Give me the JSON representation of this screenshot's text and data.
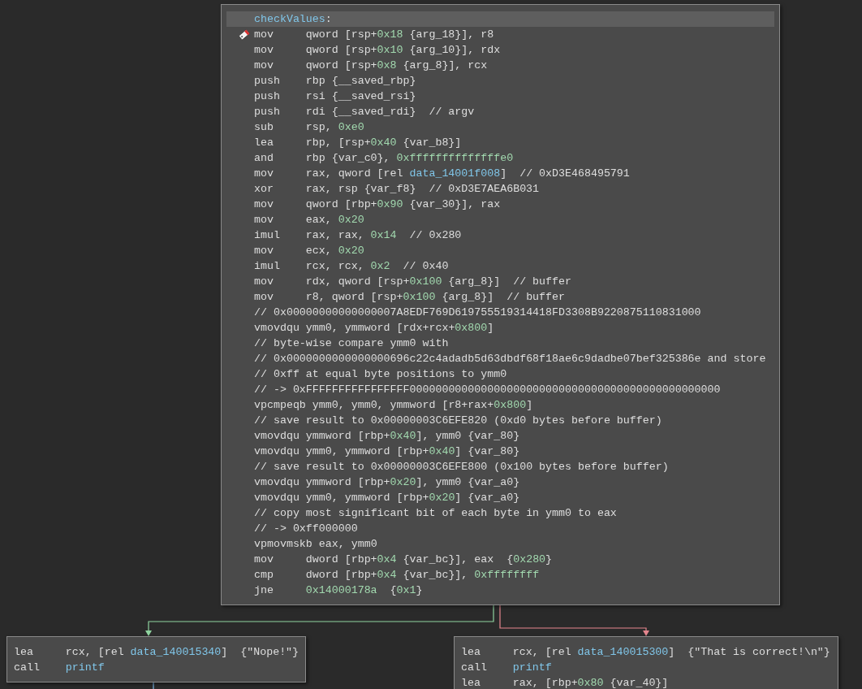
{
  "graph": {
    "blocks": [
      {
        "label": "checkValues:",
        "lines": [
          {
            "kind": "instr",
            "mnemonic": "mov",
            "operands": "qword [rsp+0x18 {arg_18}], r8",
            "tagged": true
          },
          {
            "kind": "instr",
            "mnemonic": "mov",
            "operands": "qword [rsp+0x10 {arg_10}], rdx"
          },
          {
            "kind": "instr",
            "mnemonic": "mov",
            "operands": "qword [rsp+0x8 {arg_8}], rcx"
          },
          {
            "kind": "instr",
            "mnemonic": "push",
            "operands": "rbp {__saved_rbp}"
          },
          {
            "kind": "instr",
            "mnemonic": "push",
            "operands": "rsi {__saved_rsi}"
          },
          {
            "kind": "instr",
            "mnemonic": "push",
            "operands": "rdi {__saved_rdi}  // argv"
          },
          {
            "kind": "instr",
            "mnemonic": "sub",
            "operands": "rsp, 0xe0"
          },
          {
            "kind": "instr",
            "mnemonic": "lea",
            "operands": "rbp, [rsp+0x40 {var_b8}]"
          },
          {
            "kind": "instr",
            "mnemonic": "and",
            "operands": "rbp {var_c0}, 0xffffffffffffffe0"
          },
          {
            "kind": "instr",
            "mnemonic": "mov",
            "operands": "rax, qword [rel data_14001f008]  // 0xD3E468495791"
          },
          {
            "kind": "instr",
            "mnemonic": "xor",
            "operands": "rax, rsp {var_f8}  // 0xD3E7AEA6B031"
          },
          {
            "kind": "instr",
            "mnemonic": "mov",
            "operands": "qword [rbp+0x90 {var_30}], rax"
          },
          {
            "kind": "instr",
            "mnemonic": "mov",
            "operands": "eax, 0x20"
          },
          {
            "kind": "instr",
            "mnemonic": "imul",
            "operands": "rax, rax, 0x14  // 0x280"
          },
          {
            "kind": "instr",
            "mnemonic": "mov",
            "operands": "ecx, 0x20"
          },
          {
            "kind": "instr",
            "mnemonic": "imul",
            "operands": "rcx, rcx, 0x2  // 0x40"
          },
          {
            "kind": "instr",
            "mnemonic": "mov",
            "operands": "rdx, qword [rsp+0x100 {arg_8}]  // buffer"
          },
          {
            "kind": "instr",
            "mnemonic": "mov",
            "operands": "r8, qword [rsp+0x100 {arg_8}]  // buffer"
          },
          {
            "kind": "comment",
            "text": "// 0x00000000000000007A8EDF769D619755519314418FD3308B9220875110831000"
          },
          {
            "kind": "instr",
            "mnemonic": "vmovdqu",
            "operands": "ymm0, ymmword [rdx+rcx+0x800]"
          },
          {
            "kind": "comment",
            "text": "// byte-wise compare ymm0 with"
          },
          {
            "kind": "comment",
            "text": "// 0x0000000000000000696c22c4adadb5d63dbdf68f18ae6c9dadbe07bef325386e and store"
          },
          {
            "kind": "comment",
            "text": "// 0xff at equal byte positions to ymm0"
          },
          {
            "kind": "comment",
            "text": "// -> 0xFFFFFFFFFFFFFFFF000000000000000000000000000000000000000000000000"
          },
          {
            "kind": "instr",
            "mnemonic": "vpcmpeqb",
            "operands": "ymm0, ymm0, ymmword [r8+rax+0x800]"
          },
          {
            "kind": "comment",
            "text": "// save result to 0x00000003C6EFE820 (0xd0 bytes before buffer)"
          },
          {
            "kind": "instr",
            "mnemonic": "vmovdqu",
            "operands": "ymmword [rbp+0x40], ymm0 {var_80}"
          },
          {
            "kind": "instr",
            "mnemonic": "vmovdqu",
            "operands": "ymm0, ymmword [rbp+0x40] {var_80}"
          },
          {
            "kind": "comment",
            "text": "// save result to 0x00000003C6EFE800 (0x100 bytes before buffer)"
          },
          {
            "kind": "instr",
            "mnemonic": "vmovdqu",
            "operands": "ymmword [rbp+0x20], ymm0 {var_a0}"
          },
          {
            "kind": "instr",
            "mnemonic": "vmovdqu",
            "operands": "ymm0, ymmword [rbp+0x20] {var_a0}"
          },
          {
            "kind": "comment",
            "text": "// copy most significant bit of each byte in ymm0 to eax"
          },
          {
            "kind": "comment",
            "text": "// -> 0xff000000"
          },
          {
            "kind": "instr",
            "mnemonic": "vpmovmskb",
            "operands": "eax, ymm0"
          },
          {
            "kind": "instr",
            "mnemonic": "mov",
            "operands": "dword [rbp+0x4 {var_bc}], eax  {0x280}"
          },
          {
            "kind": "instr",
            "mnemonic": "cmp",
            "operands": "dword [rbp+0x4 {var_bc}], 0xffffffff"
          },
          {
            "kind": "instr",
            "mnemonic": "jne",
            "operands": "0x14000178a  {0x1}"
          }
        ]
      },
      {
        "lines": [
          {
            "kind": "instr",
            "mnemonic": "lea",
            "operands": "rcx, [rel data_140015340]  {\"Nope!\"}"
          },
          {
            "kind": "call",
            "mnemonic": "call",
            "operands": "printf"
          }
        ]
      },
      {
        "lines": [
          {
            "kind": "instr",
            "mnemonic": "lea",
            "operands": "rcx, [rel data_140015300]  {\"That is correct!\\n\"}"
          },
          {
            "kind": "call",
            "mnemonic": "call",
            "operands": "printf"
          },
          {
            "kind": "instr",
            "mnemonic": "lea",
            "operands": "rax, [rbp+0x80 {var_40}]"
          }
        ]
      }
    ],
    "edges": [
      {
        "kind": "true"
      },
      {
        "kind": "false"
      },
      {
        "kind": "unconditional"
      }
    ]
  }
}
